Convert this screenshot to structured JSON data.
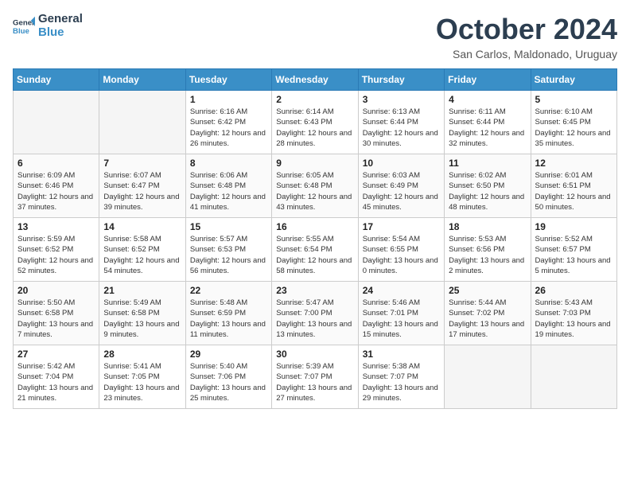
{
  "header": {
    "logo_general": "General",
    "logo_blue": "Blue",
    "month": "October 2024",
    "location": "San Carlos, Maldonado, Uruguay"
  },
  "weekdays": [
    "Sunday",
    "Monday",
    "Tuesday",
    "Wednesday",
    "Thursday",
    "Friday",
    "Saturday"
  ],
  "weeks": [
    [
      {
        "day": "",
        "info": ""
      },
      {
        "day": "",
        "info": ""
      },
      {
        "day": "1",
        "info": "Sunrise: 6:16 AM\nSunset: 6:42 PM\nDaylight: 12 hours and 26 minutes."
      },
      {
        "day": "2",
        "info": "Sunrise: 6:14 AM\nSunset: 6:43 PM\nDaylight: 12 hours and 28 minutes."
      },
      {
        "day": "3",
        "info": "Sunrise: 6:13 AM\nSunset: 6:44 PM\nDaylight: 12 hours and 30 minutes."
      },
      {
        "day": "4",
        "info": "Sunrise: 6:11 AM\nSunset: 6:44 PM\nDaylight: 12 hours and 32 minutes."
      },
      {
        "day": "5",
        "info": "Sunrise: 6:10 AM\nSunset: 6:45 PM\nDaylight: 12 hours and 35 minutes."
      }
    ],
    [
      {
        "day": "6",
        "info": "Sunrise: 6:09 AM\nSunset: 6:46 PM\nDaylight: 12 hours and 37 minutes."
      },
      {
        "day": "7",
        "info": "Sunrise: 6:07 AM\nSunset: 6:47 PM\nDaylight: 12 hours and 39 minutes."
      },
      {
        "day": "8",
        "info": "Sunrise: 6:06 AM\nSunset: 6:48 PM\nDaylight: 12 hours and 41 minutes."
      },
      {
        "day": "9",
        "info": "Sunrise: 6:05 AM\nSunset: 6:48 PM\nDaylight: 12 hours and 43 minutes."
      },
      {
        "day": "10",
        "info": "Sunrise: 6:03 AM\nSunset: 6:49 PM\nDaylight: 12 hours and 45 minutes."
      },
      {
        "day": "11",
        "info": "Sunrise: 6:02 AM\nSunset: 6:50 PM\nDaylight: 12 hours and 48 minutes."
      },
      {
        "day": "12",
        "info": "Sunrise: 6:01 AM\nSunset: 6:51 PM\nDaylight: 12 hours and 50 minutes."
      }
    ],
    [
      {
        "day": "13",
        "info": "Sunrise: 5:59 AM\nSunset: 6:52 PM\nDaylight: 12 hours and 52 minutes."
      },
      {
        "day": "14",
        "info": "Sunrise: 5:58 AM\nSunset: 6:52 PM\nDaylight: 12 hours and 54 minutes."
      },
      {
        "day": "15",
        "info": "Sunrise: 5:57 AM\nSunset: 6:53 PM\nDaylight: 12 hours and 56 minutes."
      },
      {
        "day": "16",
        "info": "Sunrise: 5:55 AM\nSunset: 6:54 PM\nDaylight: 12 hours and 58 minutes."
      },
      {
        "day": "17",
        "info": "Sunrise: 5:54 AM\nSunset: 6:55 PM\nDaylight: 13 hours and 0 minutes."
      },
      {
        "day": "18",
        "info": "Sunrise: 5:53 AM\nSunset: 6:56 PM\nDaylight: 13 hours and 2 minutes."
      },
      {
        "day": "19",
        "info": "Sunrise: 5:52 AM\nSunset: 6:57 PM\nDaylight: 13 hours and 5 minutes."
      }
    ],
    [
      {
        "day": "20",
        "info": "Sunrise: 5:50 AM\nSunset: 6:58 PM\nDaylight: 13 hours and 7 minutes."
      },
      {
        "day": "21",
        "info": "Sunrise: 5:49 AM\nSunset: 6:58 PM\nDaylight: 13 hours and 9 minutes."
      },
      {
        "day": "22",
        "info": "Sunrise: 5:48 AM\nSunset: 6:59 PM\nDaylight: 13 hours and 11 minutes."
      },
      {
        "day": "23",
        "info": "Sunrise: 5:47 AM\nSunset: 7:00 PM\nDaylight: 13 hours and 13 minutes."
      },
      {
        "day": "24",
        "info": "Sunrise: 5:46 AM\nSunset: 7:01 PM\nDaylight: 13 hours and 15 minutes."
      },
      {
        "day": "25",
        "info": "Sunrise: 5:44 AM\nSunset: 7:02 PM\nDaylight: 13 hours and 17 minutes."
      },
      {
        "day": "26",
        "info": "Sunrise: 5:43 AM\nSunset: 7:03 PM\nDaylight: 13 hours and 19 minutes."
      }
    ],
    [
      {
        "day": "27",
        "info": "Sunrise: 5:42 AM\nSunset: 7:04 PM\nDaylight: 13 hours and 21 minutes."
      },
      {
        "day": "28",
        "info": "Sunrise: 5:41 AM\nSunset: 7:05 PM\nDaylight: 13 hours and 23 minutes."
      },
      {
        "day": "29",
        "info": "Sunrise: 5:40 AM\nSunset: 7:06 PM\nDaylight: 13 hours and 25 minutes."
      },
      {
        "day": "30",
        "info": "Sunrise: 5:39 AM\nSunset: 7:07 PM\nDaylight: 13 hours and 27 minutes."
      },
      {
        "day": "31",
        "info": "Sunrise: 5:38 AM\nSunset: 7:07 PM\nDaylight: 13 hours and 29 minutes."
      },
      {
        "day": "",
        "info": ""
      },
      {
        "day": "",
        "info": ""
      }
    ]
  ]
}
